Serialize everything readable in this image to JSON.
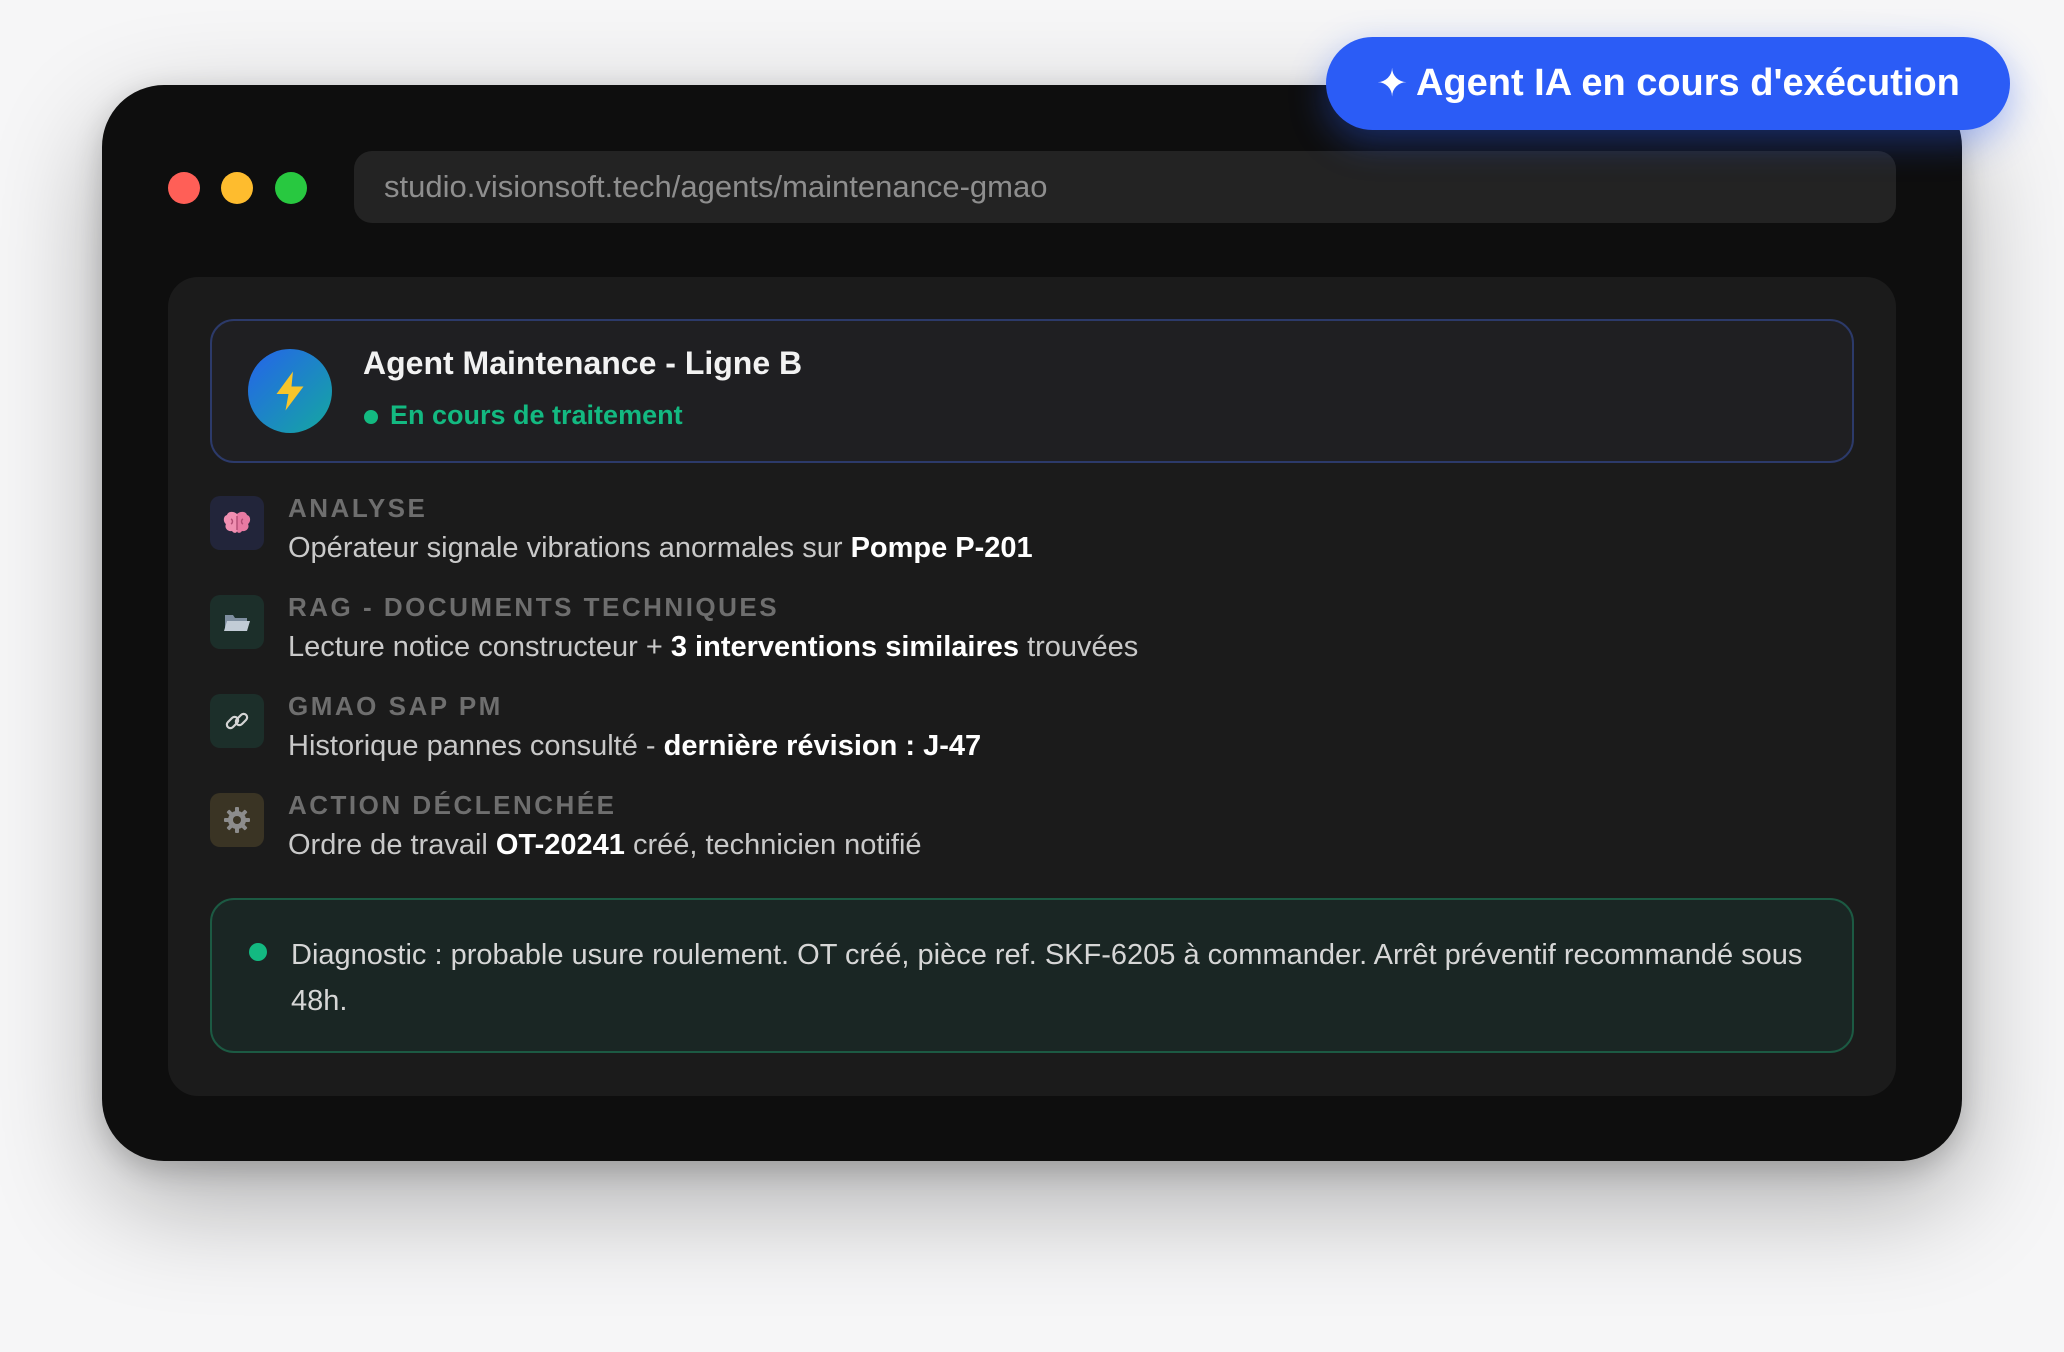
{
  "badge": {
    "icon": "sparkle-icon",
    "glyph": "✦",
    "label": "Agent IA en cours d'exécution"
  },
  "browser": {
    "url": "studio.visionsoft.tech/agents/maintenance-gmao"
  },
  "agent": {
    "name": "Agent Maintenance - Ligne B",
    "status": "En cours de traitement",
    "icon": "lightning-icon",
    "glyph": "⚡"
  },
  "steps": [
    {
      "label": "ANALYSE",
      "icon": "brain-icon",
      "desc_plain": "Opérateur signale vibrations anormales sur ",
      "desc_bold": "Pompe P-201",
      "desc_after": ""
    },
    {
      "label": "RAG - DOCUMENTS TECHNIQUES",
      "icon": "folder-icon",
      "desc_plain": "Lecture notice constructeur + ",
      "desc_bold": "3 interventions similaires",
      "desc_after": " trouvées"
    },
    {
      "label": "GMAO SAP PM",
      "icon": "link-icon",
      "desc_plain": "Historique pannes consulté - ",
      "desc_bold": "dernière révision : J-47",
      "desc_after": ""
    },
    {
      "label": "ACTION DÉCLENCHÉE",
      "icon": "gear-icon",
      "desc_plain": "Ordre de travail ",
      "desc_bold": "OT-20241",
      "desc_after": " créé, technicien notifié"
    }
  ],
  "diagnostic": {
    "text": "Diagnostic : probable usure roulement. OT créé, pièce ref. SKF-6205 à commander. Arrêt préventif recommandé sous 48h."
  },
  "colors": {
    "accent": "#2b5cf6",
    "success": "#13b981",
    "window_bg": "#0e0e0e",
    "panel_bg": "#1b1b1b"
  }
}
